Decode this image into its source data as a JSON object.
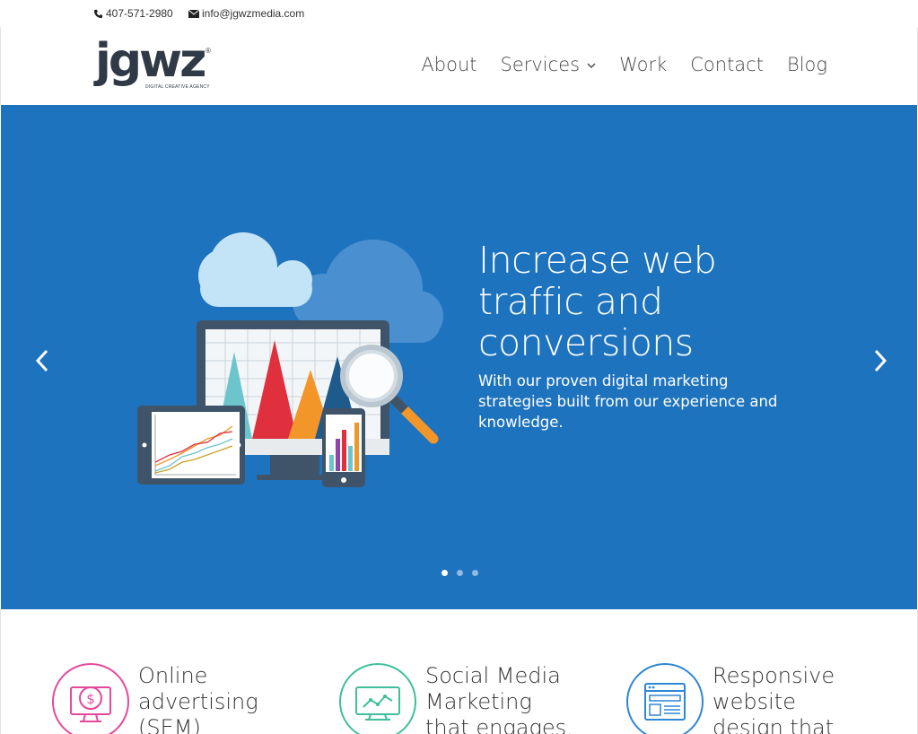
{
  "topbar": {
    "phone": "407-571-2980",
    "email": "info@jgwzmedia.com"
  },
  "logo": {
    "wordmark": "jgwz",
    "registered": "®",
    "tagline": "DIGITAL CREATIVE AGENCY"
  },
  "nav": {
    "items": [
      {
        "label": "About"
      },
      {
        "label": "Services"
      },
      {
        "label": "Work"
      },
      {
        "label": "Contact"
      },
      {
        "label": "Blog"
      }
    ]
  },
  "hero": {
    "title": "Increase web traffic and conversions",
    "subtitle": "With our proven digital marketing strategies built from our experience and knowledge.",
    "prev_icon": "chevron-left-icon",
    "next_icon": "chevron-right-icon",
    "slides_count": 3,
    "active_slide": 1,
    "background_color": "#1e73be"
  },
  "services": [
    {
      "title": "Online\nadvertising\n(SEM)",
      "icon": "monitor-dollar-icon",
      "color": "#e5489a"
    },
    {
      "title": "Social Media\nMarketing\nthat engages,",
      "icon": "monitor-chart-icon",
      "color": "#3fbf9b"
    },
    {
      "title": "Responsive\nwebsite\ndesign that",
      "icon": "browser-window-icon",
      "color": "#2e86d6"
    }
  ]
}
